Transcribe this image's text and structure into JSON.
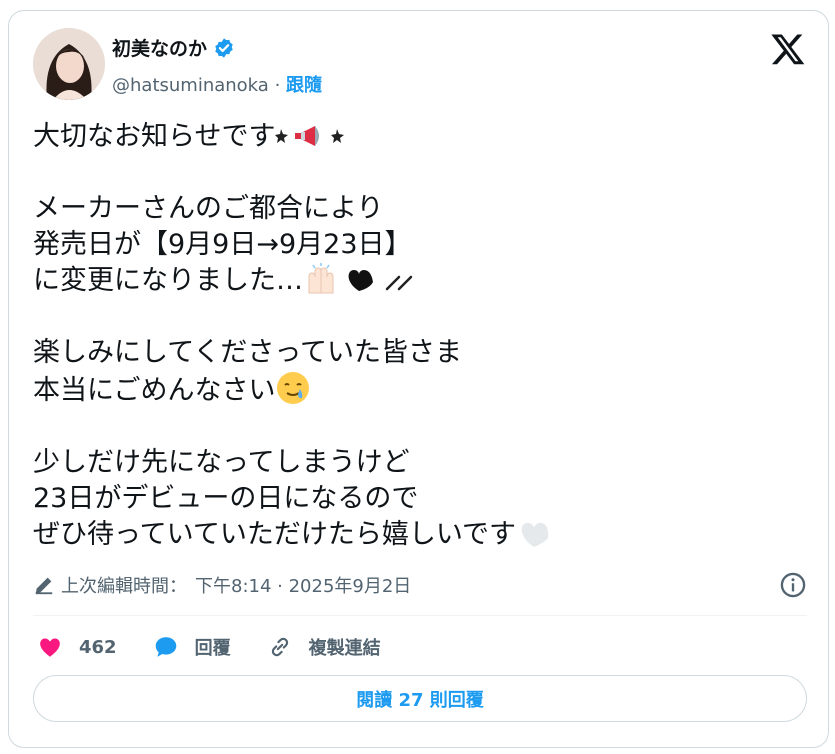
{
  "header": {
    "display_name": "初美なのか",
    "handle": "@hatsuminanoka",
    "separator": "·",
    "follow_label": "跟隨"
  },
  "tweet": {
    "lines": [
      "大切なお知らせです",
      "",
      "メーカーさんのご都合により",
      "発売日が【9月9日→9月23日】",
      "に変更になりました…",
      "",
      "楽しみにしてくださっていた皆さま",
      "本当にごめんなさい",
      "",
      "少しだけ先になってしまうけど",
      "23日がデビューの日になるので",
      "ぜひ待っていていただけたら嬉しいです"
    ]
  },
  "meta": {
    "edited_label": "上次編輯時間：",
    "timestamp": "下午8:14 · 2025年9月2日"
  },
  "actions": {
    "like_count": "462",
    "reply_label": "回覆",
    "copy_link_label": "複製連結"
  },
  "read_replies_label": "閱讀 27 則回覆",
  "colors": {
    "accent": "#1d9bf0",
    "like": "#f91880",
    "muted": "#536471"
  }
}
